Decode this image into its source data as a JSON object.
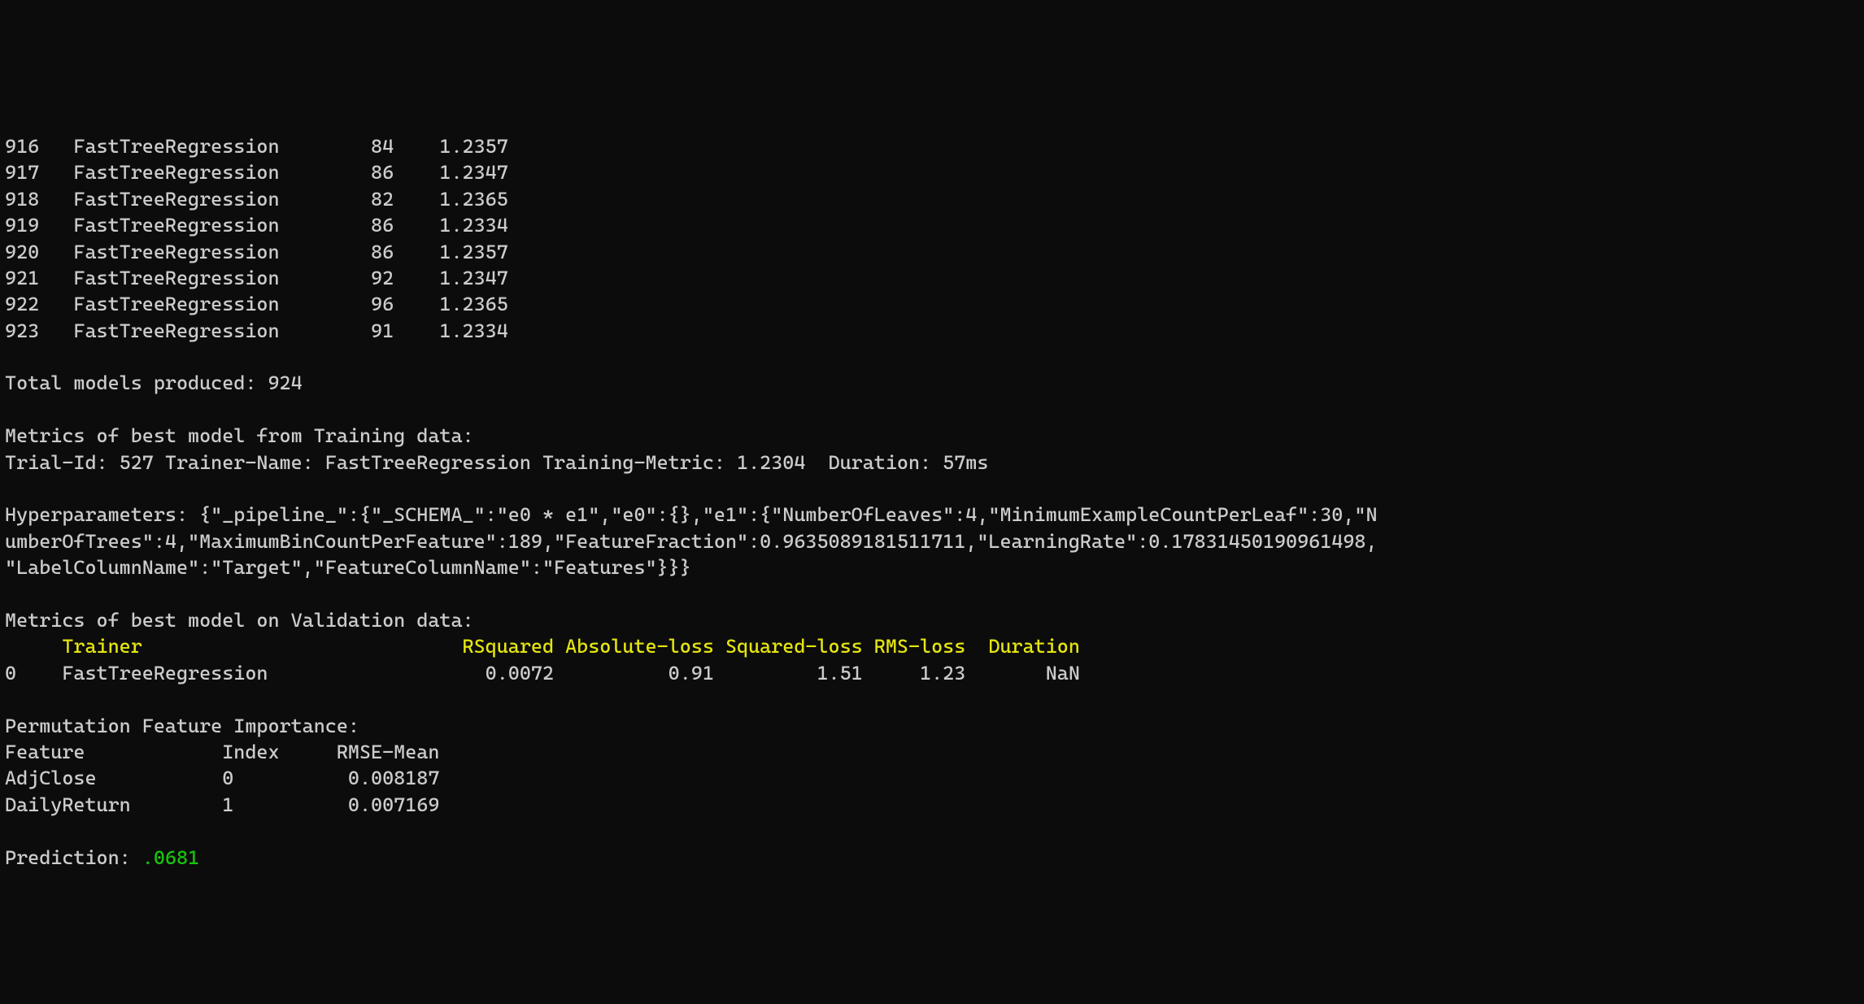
{
  "rows": [
    {
      "idx": "916",
      "trainer": "FastTreeRegression",
      "c3": "84",
      "c4": "1.2357"
    },
    {
      "idx": "917",
      "trainer": "FastTreeRegression",
      "c3": "86",
      "c4": "1.2347"
    },
    {
      "idx": "918",
      "trainer": "FastTreeRegression",
      "c3": "82",
      "c4": "1.2365"
    },
    {
      "idx": "919",
      "trainer": "FastTreeRegression",
      "c3": "86",
      "c4": "1.2334"
    },
    {
      "idx": "920",
      "trainer": "FastTreeRegression",
      "c3": "86",
      "c4": "1.2357"
    },
    {
      "idx": "921",
      "trainer": "FastTreeRegression",
      "c3": "92",
      "c4": "1.2347"
    },
    {
      "idx": "922",
      "trainer": "FastTreeRegression",
      "c3": "96",
      "c4": "1.2365"
    },
    {
      "idx": "923",
      "trainer": "FastTreeRegression",
      "c3": "91",
      "c4": "1.2334"
    }
  ],
  "total_models_label": "Total models produced: 924",
  "train_header": "Metrics of best model from Training data:",
  "train_line": "Trial-Id: 527 Trainer-Name: FastTreeRegression Training-Metric: 1.2304  Duration: 57ms",
  "hparams_label": "Hyperparameters: ",
  "hparams_l1": "{\"_pipeline_\":{\"_SCHEMA_\":\"e0 * e1\",\"e0\":{},\"e1\":{\"NumberOfLeaves\":4,\"MinimumExampleCountPerLeaf\":30,\"N",
  "hparams_l2": "umberOfTrees\":4,\"MaximumBinCountPerFeature\":189,\"FeatureFraction\":0.9635089181511711,\"LearningRate\":0.17831450190961498,",
  "hparams_l3": "\"LabelColumnName\":\"Target\",\"FeatureColumnName\":\"Features\"}}}",
  "val_header": "Metrics of best model on Validation data:",
  "val_cols": {
    "trainer": "Trainer",
    "rsq": "RSquared",
    "abs": "Absolute-loss",
    "sq": "Squared-loss",
    "rms": "RMS-loss",
    "dur": "Duration"
  },
  "val_row": {
    "idx": "0",
    "trainer": "FastTreeRegression",
    "rsq": "0.0072",
    "abs": "0.91",
    "sq": "1.51",
    "rms": "1.23",
    "dur": "NaN"
  },
  "pfi_header": "Permutation Feature Importance:",
  "pfi_cols": {
    "feature": "Feature",
    "index": "Index",
    "rmse": "RMSE-Mean"
  },
  "pfi_rows": [
    {
      "feature": "AdjClose",
      "index": "0",
      "rmse": "0.008187"
    },
    {
      "feature": "DailyReturn",
      "index": "1",
      "rmse": "0.007169"
    }
  ],
  "pred_label": "Prediction: ",
  "pred_value": ".0681"
}
